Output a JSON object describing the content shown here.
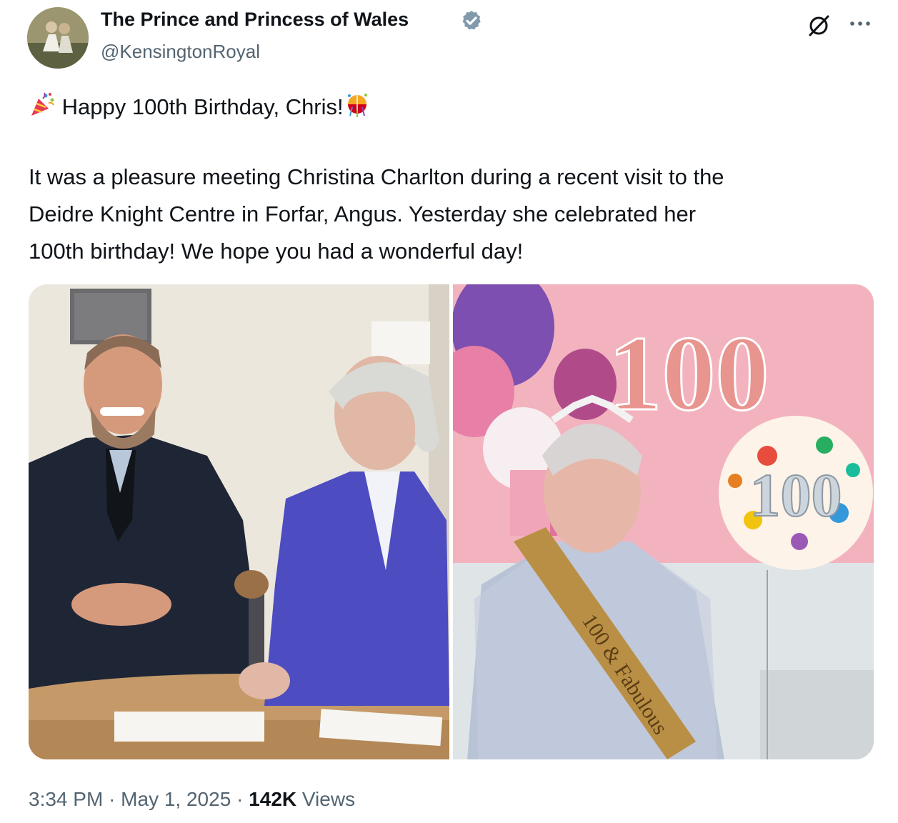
{
  "account": {
    "display_name": "The Prince and Princess of Wales",
    "handle": "@KensingtonRoyal",
    "verified_icon": "verified-badge-icon",
    "avatar": "profile-avatar"
  },
  "header_actions": {
    "grok_icon": "grok-icon",
    "more_icon": "more-options-icon"
  },
  "post": {
    "headline": "Happy 100th Birthday, Chris!",
    "headline_emoji_left": "party-popper",
    "headline_emoji_right": "confetti-ball",
    "body_lines": [
      "It was a pleasure meeting Christina Charlton during a recent visit to the",
      "Deidre Knight Centre in Forfar, Angus. Yesterday she celebrated her",
      "100th birthday! We hope you had a wonderful day!"
    ]
  },
  "media": {
    "photo_left": "photo-visit-meeting",
    "photo_right": "photo-100th-birthday",
    "balloon_text": "100",
    "sash_text": "100 & Fabulous"
  },
  "meta": {
    "time": "3:34 PM",
    "sep1": " · ",
    "date": "May 1, 2025",
    "sep2": " · ",
    "views_count": "142K",
    "views_label": " Views"
  },
  "colors": {
    "text": "#0f1419",
    "secondary": "#536471",
    "verified": "#829aab",
    "party_pink": "#f2b3bf"
  }
}
